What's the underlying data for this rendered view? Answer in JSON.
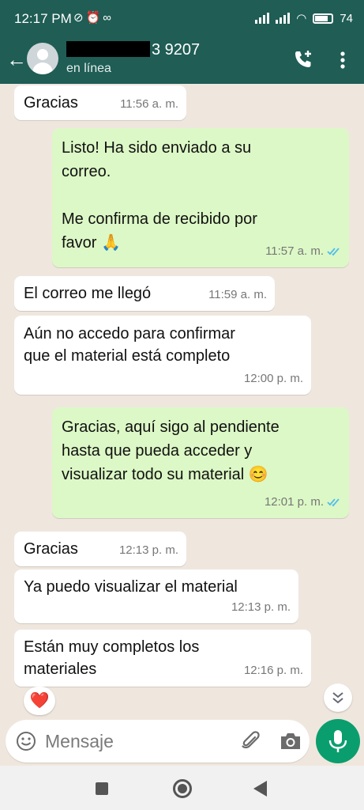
{
  "status_bar": {
    "time": "12:17 PM",
    "battery": "74"
  },
  "header": {
    "contact_name": "3 9207",
    "contact_status": "en línea"
  },
  "messages": [
    {
      "direction": "in",
      "text": "Gracias",
      "time": "11:56 a. m."
    },
    {
      "direction": "out",
      "text": "Listo! Ha sido enviado a su\ncorreo.\n\nMe confirma de recibido por\nfavor 🙏",
      "time": "11:57 a. m.",
      "status": "read"
    },
    {
      "direction": "in",
      "text": "El correo me llegó",
      "time": "11:59 a. m."
    },
    {
      "direction": "in",
      "text": "Aún no accedo para confirmar\nque el material está completo",
      "time": "12:00 p. m."
    },
    {
      "direction": "out",
      "text": "Gracias, aquí sigo al pendiente\nhasta que pueda acceder y\nvisualizar todo su material 😊",
      "time": "12:01 p. m.",
      "status": "read"
    },
    {
      "direction": "in",
      "text": "Gracias",
      "time": "12:13 p. m."
    },
    {
      "direction": "in",
      "text": "Ya puedo visualizar el material",
      "time": "12:13 p. m."
    },
    {
      "direction": "in",
      "text": "Están muy completos los\nmateriales",
      "time": "12:16 p. m."
    }
  ],
  "reaction": "❤️",
  "composer": {
    "placeholder": "Mensaje"
  },
  "colors": {
    "header": "#1f5d55",
    "outgoing_bubble": "#dcf8c6",
    "incoming_bubble": "#ffffff",
    "chat_background": "#efe7de",
    "read_ticks": "#53bdeb",
    "mic_button": "#0a9e6e"
  },
  "icons": [
    "back-arrow-icon",
    "avatar",
    "add-call-icon",
    "more-options-icon",
    "emoji-icon",
    "attach-icon",
    "camera-icon",
    "mic-icon",
    "scroll-down-icon"
  ]
}
